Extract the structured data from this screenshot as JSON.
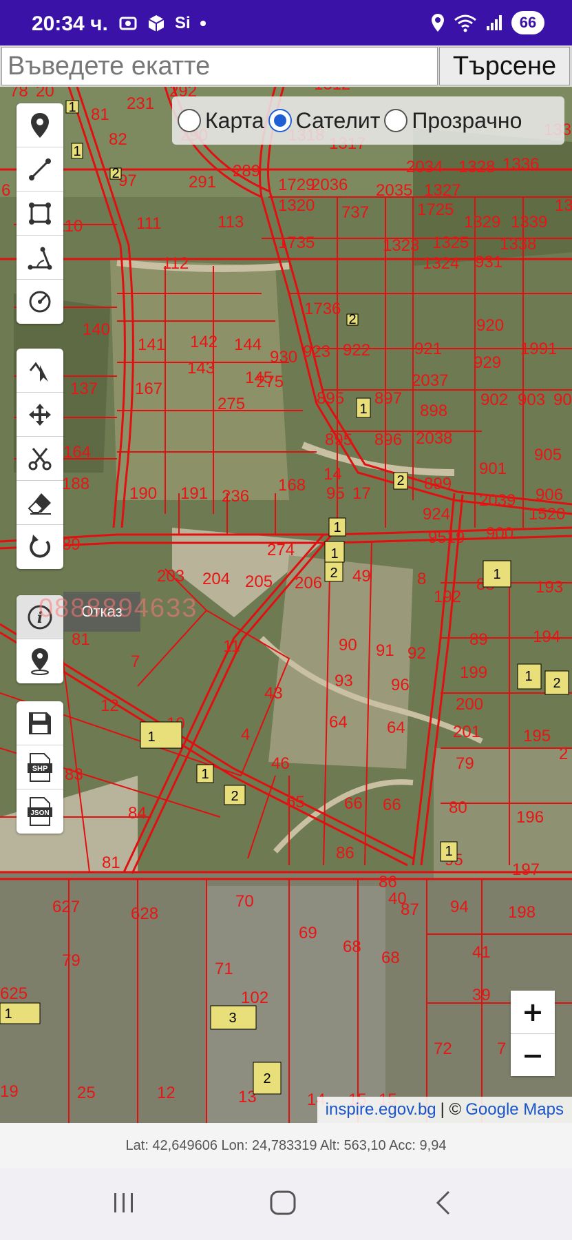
{
  "status_bar": {
    "time": "20:34 ч.",
    "battery": "66",
    "sim_label": "Si"
  },
  "search": {
    "placeholder": "Въведете екатте",
    "value": "",
    "button_label": "Търсене"
  },
  "map_type": {
    "options": [
      {
        "label": "Карта",
        "selected": false
      },
      {
        "label": "Сателит",
        "selected": true
      },
      {
        "label": "Прозрачно",
        "selected": false
      }
    ]
  },
  "tools": {
    "group1": [
      "marker-icon",
      "line-icon",
      "polygon-icon",
      "angle-icon",
      "circle-measure-icon"
    ],
    "group2": [
      "select-vertex-icon",
      "move-icon",
      "scissors-icon",
      "eraser-icon",
      "undo-icon"
    ],
    "group3": [
      "info-icon",
      "location-pin-icon"
    ],
    "group4": [
      "save-icon",
      "shp-file-icon",
      "json-file-icon"
    ]
  },
  "tooltip": {
    "label": "Отказ",
    "phone_watermark": "0888894633"
  },
  "zoom": {
    "plus": "+",
    "minus": "−"
  },
  "attribution": {
    "link1": "inspire.egov.bg",
    "separator": "| ©",
    "link2": "Google Maps"
  },
  "coordinates": "Lat: 42,649606 Lon: 24,783319 Alt: 563,10 Acc: 9,94",
  "parcel_labels": [
    "78",
    "20",
    "292",
    "1312",
    "231",
    "81",
    "82",
    "290",
    "1318",
    "1317",
    "2034",
    "1328",
    "1336",
    "133",
    "97",
    "289",
    "291",
    "1729",
    "2036",
    "2035",
    "1327",
    "6",
    "110",
    "111",
    "113",
    "1320",
    "737",
    "1725",
    "1329",
    "1339",
    "13",
    "112",
    "1735",
    "1323",
    "1325",
    "1338",
    "140",
    "1736",
    "1324",
    "920",
    "931",
    "141",
    "142",
    "144",
    "930",
    "923",
    "922",
    "921",
    "929",
    "1991",
    "137",
    "143",
    "145",
    "2037",
    "167",
    "275",
    "895",
    "897",
    "902",
    "903",
    "90",
    "898",
    "164",
    "895",
    "896",
    "2038",
    "905",
    "188",
    "190",
    "191",
    "236",
    "168",
    "899",
    "906",
    "275",
    "14",
    "95",
    "17",
    "901",
    "2039",
    "924",
    "1520",
    "89",
    "274",
    "2",
    "900",
    "9519",
    "203",
    "204",
    "205",
    "206",
    "49",
    "8",
    "192",
    "88",
    "193",
    "81",
    "7",
    "11",
    "90",
    "91",
    "92",
    "89",
    "194",
    "93",
    "96",
    "199",
    "43",
    "200",
    "10",
    "64",
    "64",
    "4",
    "201",
    "195",
    "12",
    "83",
    "46",
    "79",
    "2",
    "84",
    "65",
    "66",
    "66",
    "80",
    "196",
    "86",
    "95",
    "81",
    "86",
    "197",
    "70",
    "87",
    "94",
    "198",
    "627",
    "628",
    "40",
    "69",
    "68",
    "68",
    "41",
    "79",
    "71",
    "39",
    "102",
    "72",
    "7",
    "25",
    "12",
    "13",
    "14",
    "15",
    "15",
    "19",
    "625"
  ],
  "building_labels": [
    "1",
    "1",
    "2",
    "2",
    "1",
    "2",
    "1",
    "1",
    "2",
    "1",
    "1",
    "1",
    "1",
    "2",
    "2",
    "1",
    "3",
    "2",
    "1"
  ]
}
